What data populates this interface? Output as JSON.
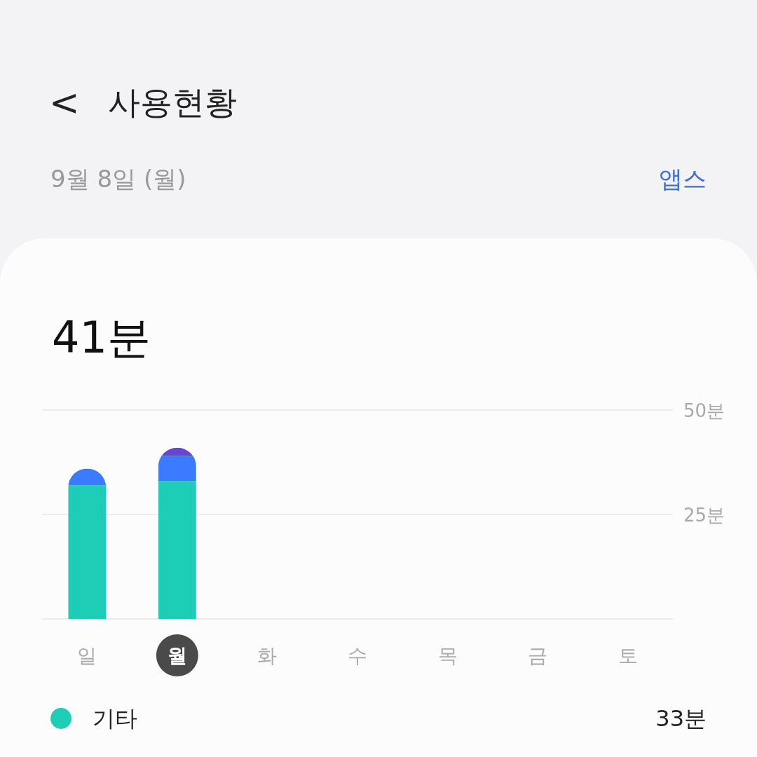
{
  "header": {
    "back": "<",
    "title": "사용현황"
  },
  "date": "9월 8일 (월)",
  "view_link": "앱스",
  "total": "41분",
  "chart_data": {
    "type": "bar",
    "stacked": true,
    "categories": [
      "일",
      "월",
      "화",
      "수",
      "목",
      "금",
      "토"
    ],
    "series": [
      {
        "name": "기타",
        "color": "#1ecdb5",
        "values": [
          32,
          33,
          null,
          null,
          null,
          null,
          null
        ]
      },
      {
        "color": "#3b7bff",
        "values": [
          4,
          6,
          null,
          null,
          null,
          null,
          null
        ]
      },
      {
        "color": "#6347cf",
        "values": [
          null,
          2,
          null,
          null,
          null,
          null,
          null
        ]
      }
    ],
    "ylim": [
      0,
      50
    ],
    "yticks": [
      {
        "value": 25,
        "label": "25분"
      },
      {
        "value": 50,
        "label": "50분"
      }
    ]
  },
  "days": [
    {
      "selected": false
    },
    {
      "selected": true
    },
    {
      "selected": false
    },
    {
      "selected": false
    },
    {
      "selected": false
    },
    {
      "selected": false
    },
    {
      "selected": false
    }
  ],
  "legend": [
    {
      "value": "33분"
    }
  ]
}
